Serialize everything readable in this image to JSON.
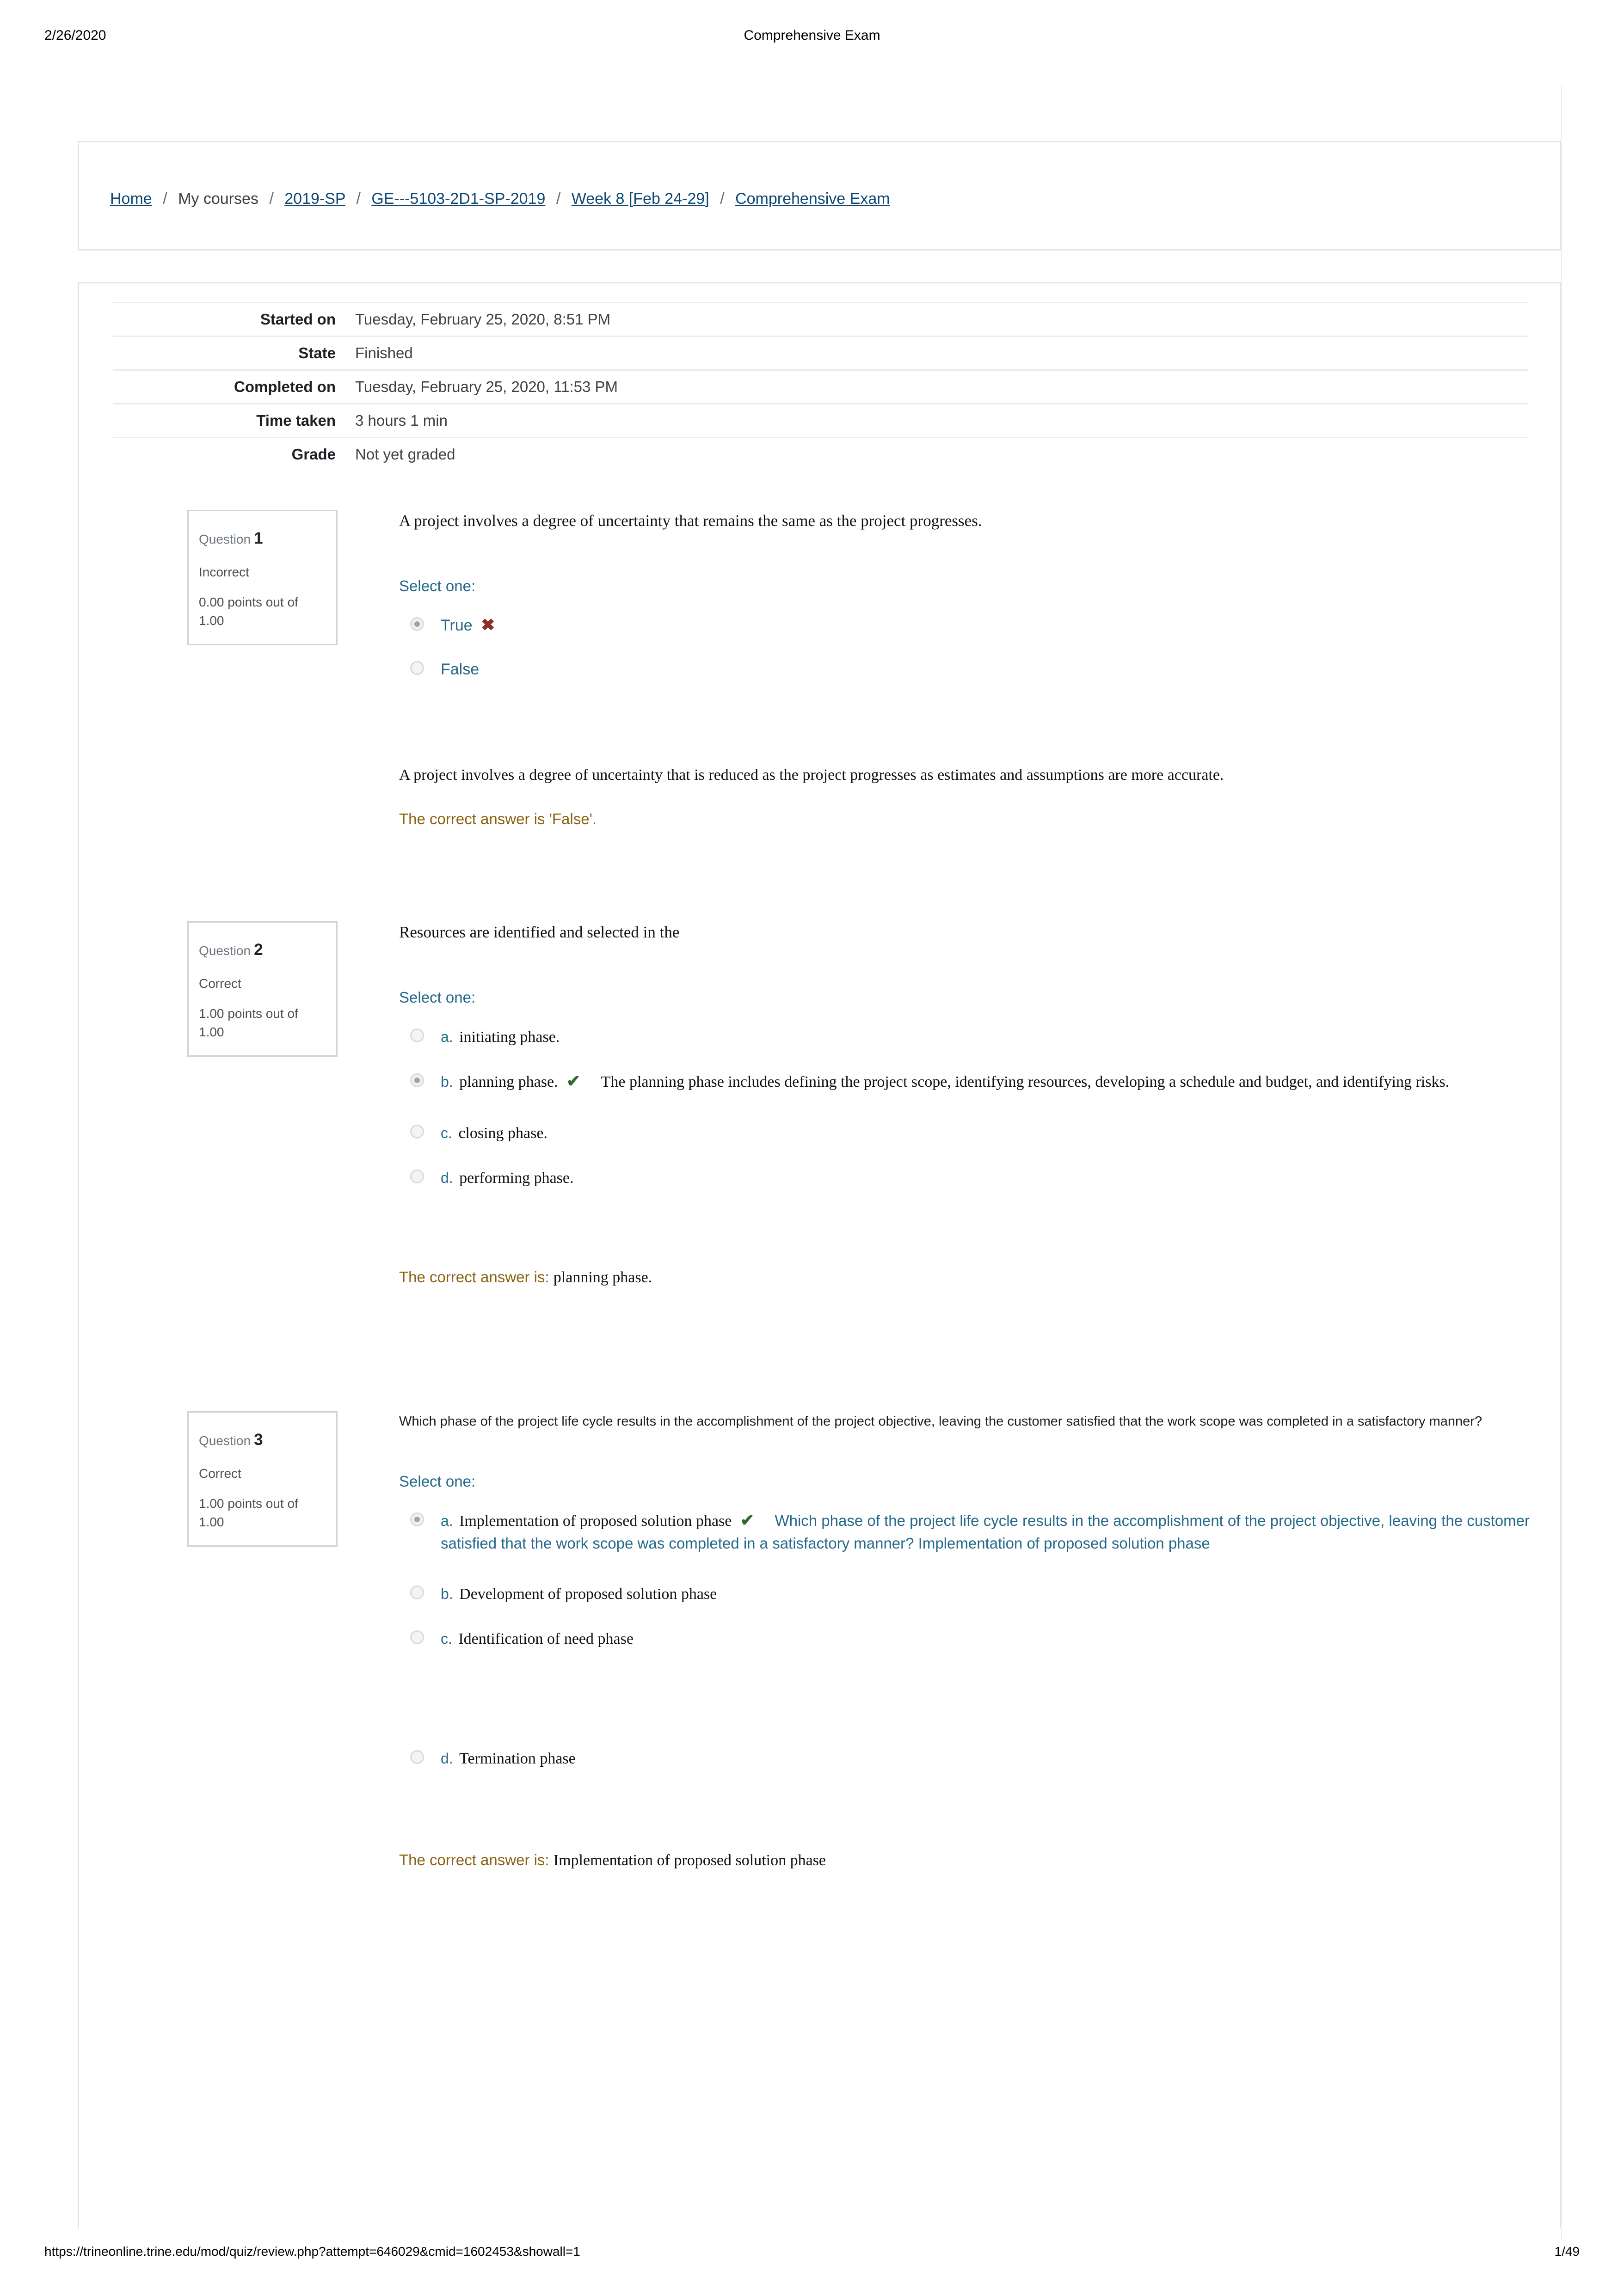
{
  "print_header": {
    "date": "2/26/2020",
    "title": "Comprehensive Exam"
  },
  "print_footer": {
    "url": "https://trineonline.trine.edu/mod/quiz/review.php?attempt=646029&cmid=1602453&showall=1",
    "page": "1/49"
  },
  "breadcrumb": {
    "separator": "/",
    "items": [
      {
        "label": "Home",
        "link": true
      },
      {
        "label": "My courses",
        "link": false
      },
      {
        "label": "2019-SP",
        "link": true
      },
      {
        "label": "GE---5103-2D1-SP-2019",
        "link": true
      },
      {
        "label": "Week 8 [Feb 24-29]",
        "link": true
      },
      {
        "label": "Comprehensive Exam",
        "link": true
      }
    ]
  },
  "summary": {
    "rows": [
      {
        "key": "Started on",
        "value": "Tuesday, February 25, 2020, 8:51 PM"
      },
      {
        "key": "State",
        "value": "Finished"
      },
      {
        "key": "Completed on",
        "value": "Tuesday, February 25, 2020, 11:53 PM"
      },
      {
        "key": "Time taken",
        "value": "3 hours 1 min"
      },
      {
        "key": "Grade",
        "value": "Not yet graded"
      }
    ]
  },
  "labels": {
    "question_word": "Question",
    "select_one": "Select one:",
    "correct_answer_is": "The correct answer is:",
    "correct_answer_is_quoted": "The correct answer is 'False'.",
    "mark_wrong": "✖",
    "mark_right": "✔"
  },
  "colors": {
    "link": "#0f4871",
    "teal": "#25698a",
    "feedback_gold": "#8a6212",
    "wrong_red": "#8e2f2c",
    "right_green": "#2f6b2f",
    "card_border": "#e2e4e6",
    "info_border": "#ccd5dd"
  },
  "questions": [
    {
      "number": "1",
      "state": "Incorrect",
      "grade": "0.00 points out of 1.00",
      "stem": "A project involves a degree of uncertainty that remains the same as the project progresses.",
      "options": [
        {
          "letter": "",
          "text": "True",
          "selected": true,
          "mark": "wrong",
          "feedback": ""
        },
        {
          "letter": "",
          "text": "False",
          "selected": false,
          "mark": "",
          "feedback": ""
        }
      ],
      "general_feedback": "A project involves a degree of uncertainty that is reduced as the project progresses as estimates and assumptions are more accurate.",
      "correct_answer_line": "The correct answer is 'False'.",
      "correct_answer_value": ""
    },
    {
      "number": "2",
      "state": "Correct",
      "grade": "1.00 points out of 1.00",
      "stem": "Resources are identified and selected in the",
      "options": [
        {
          "letter": "a.",
          "text": "initiating phase.",
          "selected": false,
          "mark": "",
          "feedback": ""
        },
        {
          "letter": "b.",
          "text": "planning phase.",
          "selected": true,
          "mark": "right",
          "feedback": "The planning phase includes defining the project scope, identifying resources, developing a schedule and budget, and identifying risks."
        },
        {
          "letter": "c.",
          "text": "closing phase.",
          "selected": false,
          "mark": "",
          "feedback": ""
        },
        {
          "letter": "d.",
          "text": "performing phase.",
          "selected": false,
          "mark": "",
          "feedback": ""
        }
      ],
      "general_feedback": "",
      "correct_answer_line": "The correct answer is:",
      "correct_answer_value": "planning phase."
    },
    {
      "number": "3",
      "state": "Correct",
      "grade": "1.00 points out of 1.00",
      "stem": "Which phase of the project life cycle results in the accomplishment of the project objective, leaving the customer satisfied that the work scope was completed in a satisfactory manner?",
      "options": [
        {
          "letter": "a.",
          "text": "Implementation of proposed solution phase",
          "selected": true,
          "mark": "right",
          "feedback": "Which phase of the project life cycle results in the accomplishment of the project objective, leaving the customer satisfied that the work scope was completed in a satisfactory manner? Implementation of proposed solution phase"
        },
        {
          "letter": "b.",
          "text": "Development of proposed solution phase",
          "selected": false,
          "mark": "",
          "feedback": ""
        },
        {
          "letter": "c.",
          "text": "Identification of need phase",
          "selected": false,
          "mark": "",
          "feedback": ""
        },
        {
          "letter": "d.",
          "text": "Termination phase",
          "selected": false,
          "mark": "",
          "feedback": ""
        }
      ],
      "general_feedback": "",
      "correct_answer_line": "The correct answer is:",
      "correct_answer_value": "Implementation of proposed solution phase"
    }
  ]
}
